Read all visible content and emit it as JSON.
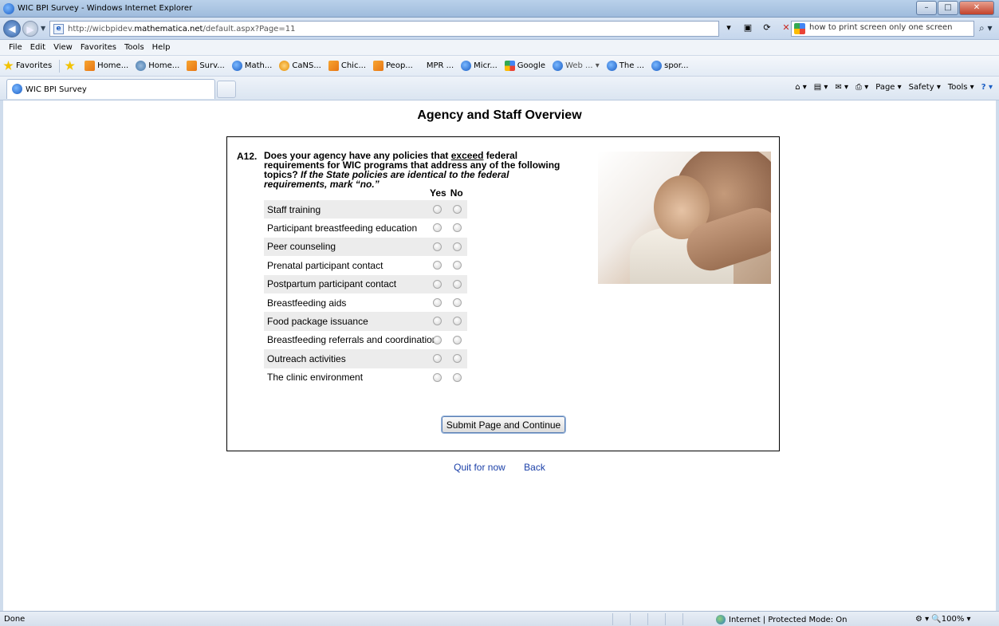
{
  "window": {
    "title": "WIC BPI Survey - Windows Internet Explorer",
    "min_glyph": "–",
    "max_glyph": "□",
    "close_glyph": "✕"
  },
  "address": {
    "url_prefix": "http://wicbpidev.",
    "url_domain": "mathematica.net",
    "url_suffix": "/default.aspx?Page=11",
    "search_value": "how to print screen only one screen"
  },
  "menu": [
    "File",
    "Edit",
    "View",
    "Favorites",
    "Tools",
    "Help"
  ],
  "favorites": {
    "label": "Favorites",
    "items": [
      {
        "label": "Home...",
        "icon": "rss-icon"
      },
      {
        "label": "Home...",
        "icon": "home-icon"
      },
      {
        "label": "Surv...",
        "icon": "rss-icon"
      },
      {
        "label": "Math...",
        "icon": "ie-icon"
      },
      {
        "label": "CaNS...",
        "icon": "cans-icon"
      },
      {
        "label": "Chic...",
        "icon": "rss-icon"
      },
      {
        "label": "Peop...",
        "icon": "rss-icon"
      },
      {
        "label": "MPR ...",
        "icon": "none"
      },
      {
        "label": "Micr...",
        "icon": "ie-icon"
      },
      {
        "label": "Google",
        "icon": "google-icon"
      },
      {
        "label": "Web ... ▾",
        "icon": "ie-icon"
      },
      {
        "label": "The ...",
        "icon": "ie-icon"
      },
      {
        "label": "spor...",
        "icon": "ie-icon"
      }
    ]
  },
  "tab": {
    "label": "WIC BPI Survey"
  },
  "commands": {
    "home": "⌂ ▾",
    "feeds": "▤ ▾",
    "mail": "✉ ▾",
    "print": "⎙ ▾",
    "page": "Page ▾",
    "safety": "Safety ▾",
    "tools": "Tools ▾",
    "help": "? ▾"
  },
  "page": {
    "title": "Agency and Staff Overview",
    "question_number": "A12.",
    "question_part1": "Does your agency have any policies that ",
    "question_underlined": "exceed",
    "question_part2": " federal requirements for WIC programs that address any of the following topics? ",
    "question_italic": "If the State policies are identical to the federal requirements, mark “no.”",
    "col_yes": "Yes",
    "col_no": "No",
    "topics": [
      "Staff training",
      "Participant breastfeeding education",
      "Peer counseling",
      "Prenatal participant contact",
      "Postpartum participant contact",
      "Breastfeeding aids",
      "Food package issuance",
      "Breastfeeding referrals and coordination",
      "Outreach activities",
      "The clinic environment"
    ],
    "submit_label": "Submit Page and Continue",
    "quit_label": "Quit for now",
    "back_label": "Back"
  },
  "status": {
    "text": "Done",
    "zone": "Internet | Protected Mode: On",
    "zoom": "⚙ ▾   🔍100%  ▾"
  }
}
